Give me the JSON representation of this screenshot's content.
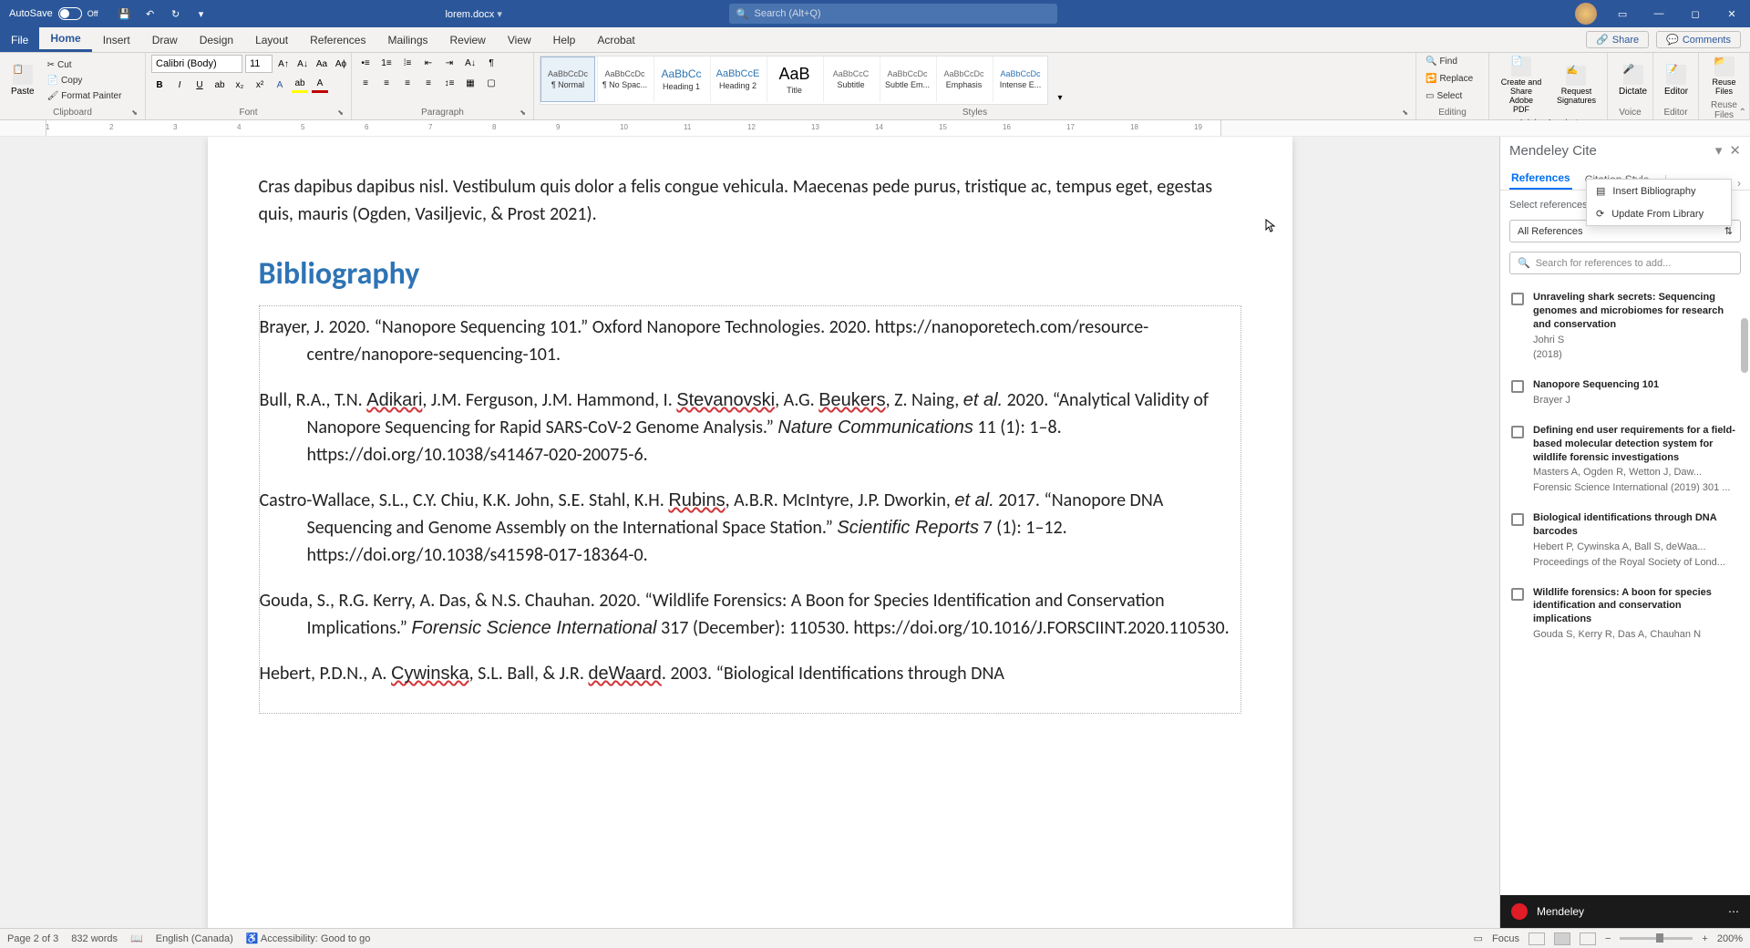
{
  "titlebar": {
    "autosave": "AutoSave",
    "autosave_state": "Off",
    "filename": "lorem.docx",
    "search_placeholder": "Search (Alt+Q)"
  },
  "tabs": {
    "file": "File",
    "home": "Home",
    "insert": "Insert",
    "draw": "Draw",
    "design": "Design",
    "layout": "Layout",
    "references": "References",
    "mailings": "Mailings",
    "review": "Review",
    "view": "View",
    "help": "Help",
    "acrobat": "Acrobat",
    "share": "Share",
    "comments": "Comments"
  },
  "ribbon": {
    "paste": "Paste",
    "cut": "Cut",
    "copy": "Copy",
    "format_painter": "Format Painter",
    "clipboard": "Clipboard",
    "font_name": "Calibri (Body)",
    "font_size": "11",
    "font": "Font",
    "paragraph": "Paragraph",
    "styles_label": "Styles",
    "styles": [
      {
        "name": "¶ Normal",
        "preview": "AaBbCcDc"
      },
      {
        "name": "¶ No Spac...",
        "preview": "AaBbCcDc"
      },
      {
        "name": "Heading 1",
        "preview": "AaBbCc"
      },
      {
        "name": "Heading 2",
        "preview": "AaBbCcE"
      },
      {
        "name": "Title",
        "preview": "AaB"
      },
      {
        "name": "Subtitle",
        "preview": "AaBbCcC"
      },
      {
        "name": "Subtle Em...",
        "preview": "AaBbCcDc"
      },
      {
        "name": "Emphasis",
        "preview": "AaBbCcDc"
      },
      {
        "name": "Intense E...",
        "preview": "AaBbCcDc"
      }
    ],
    "find": "Find",
    "replace": "Replace",
    "select": "Select",
    "editing": "Editing",
    "create_share": "Create and Share Adobe PDF",
    "req_sig": "Request Signatures",
    "adobe": "Adobe Acrobat",
    "dictate": "Dictate",
    "voice": "Voice",
    "editor": "Editor",
    "editor_g": "Editor",
    "reuse": "Reuse Files",
    "reuse_g": "Reuse Files"
  },
  "ruler_ticks": [
    "1",
    "2",
    "3",
    "4",
    "5",
    "6",
    "7",
    "8",
    "9",
    "10",
    "11",
    "12",
    "13",
    "14",
    "15",
    "16",
    "17",
    "18",
    "19"
  ],
  "document": {
    "para": "Cras dapibus dapibus nisl. Vestibulum quis dolor a felis congue vehicula. Maecenas pede purus, tristique ac, tempus eget, egestas quis, mauris (Ogden, Vasiljevic, & Prost 2021).",
    "bib_title": "Bibliography",
    "entries": [
      "Brayer, J. 2020. “Nanopore Sequencing 101.” Oxford Nanopore Technologies. 2020. https://nanoporetech.com/resource-centre/nanopore-sequencing-101.",
      "Bull, R.A., T.N. <err>Adikari</err>, J.M. Ferguson, J.M. Hammond, I. <err>Stevanovski</err>, A.G. <err>Beukers</err>, Z. Naing, <em>et al.</em> 2020. “Analytical Validity of Nanopore Sequencing for Rapid SARS-CoV-2 Genome Analysis.” <em>Nature Communications</em> 11 (1): 1–8. https://doi.org/10.1038/s41467-020-20075-6.",
      "Castro-Wallace, S.L., C.Y. Chiu, K.K. John, S.E. Stahl, K.H. <err>Rubins</err>, A.B.R. McIntyre, J.P. Dworkin, <em>et al.</em> 2017. “Nanopore DNA Sequencing and Genome Assembly on the International Space Station.” <em>Scientific Reports</em> 7 (1): 1–12. https://doi.org/10.1038/s41598-017-18364-0.",
      "Gouda, S., R.G. Kerry, A. Das, & N.S. Chauhan. 2020. “Wildlife Forensics: A Boon for Species Identification and Conservation Implications.” <em>Forensic Science International</em> 317 (December): 110530. https://doi.org/10.1016/J.FORSCIINT.2020.110530.",
      "Hebert, P.D.N., A. <err>Cywinska</err>, S.L. Ball, & J.R. <err>deWaard</err>. 2003. “Biological Identifications through DNA"
    ]
  },
  "sidepanel": {
    "title": "Mendeley Cite",
    "tab_refs": "References",
    "tab_style": "Citation Style",
    "tab_more": "More",
    "dd_insert": "Insert Bibliography",
    "dd_update": "Update From Library",
    "hint": "Select references",
    "allrefs": "All References",
    "search_ph": "Search for references to add...",
    "refs": [
      {
        "title": "Unraveling shark secrets: Sequencing genomes and microbiomes for research and conservation",
        "author": "Johri S",
        "year": "(2018)",
        "meta": ""
      },
      {
        "title": "Nanopore Sequencing 101",
        "author": "Brayer J",
        "year": "",
        "meta": ""
      },
      {
        "title": "Defining end user requirements for a field-based molecular detection system for wildlife forensic investigations",
        "author": "Masters A, Ogden R, Wetton J, Daw...",
        "year": "",
        "meta": "Forensic Science International (2019) 301 ..."
      },
      {
        "title": "Biological identifications through DNA barcodes",
        "author": "Hebert P, Cywinska A, Ball S, deWaa...",
        "year": "",
        "meta": "Proceedings of the Royal Society of Lond..."
      },
      {
        "title": "Wildlife forensics: A boon for species identification and conservation implications",
        "author": "Gouda S, Kerry R, Das A, Chauhan N",
        "year": "",
        "meta": ""
      }
    ],
    "footer": "Mendeley"
  },
  "statusbar": {
    "page": "Page 2 of 3",
    "words": "832 words",
    "lang": "English (Canada)",
    "acc": "Accessibility: Good to go",
    "focus": "Focus",
    "zoom": "200%"
  }
}
